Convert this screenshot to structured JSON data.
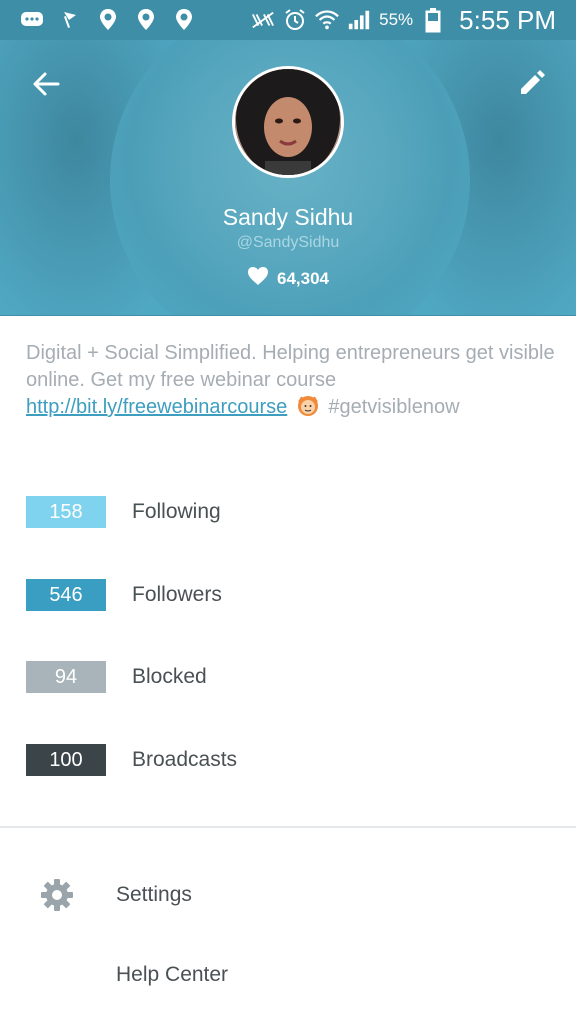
{
  "status_bar": {
    "battery": "55%",
    "time": "5:55 PM",
    "icons": [
      "message-icon",
      "flag-icon",
      "location-pin-icon",
      "location-pin-icon",
      "location-pin-icon",
      "nfc-icon",
      "alarm-icon",
      "wifi-icon",
      "signal-icon",
      "battery-icon"
    ]
  },
  "header": {
    "name": "Sandy Sidhu",
    "handle": "@SandySidhu",
    "likes": "64,304",
    "back_icon": "arrow-left-icon",
    "edit_icon": "pencil-icon"
  },
  "bio": {
    "text": "Digital + Social Simplified. Helping entrepreneurs get visible online. Get my free webinar course",
    "link": "http://bit.ly/freewebinarcourse",
    "hashtag": "#getvisiblenow"
  },
  "stats": [
    {
      "value": "158",
      "label": "Following",
      "color": "#7fd3ee"
    },
    {
      "value": "546",
      "label": "Followers",
      "color": "#3a9ec3"
    },
    {
      "value": "94",
      "label": "Blocked",
      "color": "#a8b4b9"
    },
    {
      "value": "100",
      "label": "Broadcasts",
      "color": "#3b4448"
    }
  ],
  "menu": {
    "settings": "Settings",
    "help": "Help Center"
  },
  "colors": {
    "header_bg": "#4fa8c2",
    "status_bar_bg": "#3d8ea6",
    "link": "#3d9ec0"
  }
}
